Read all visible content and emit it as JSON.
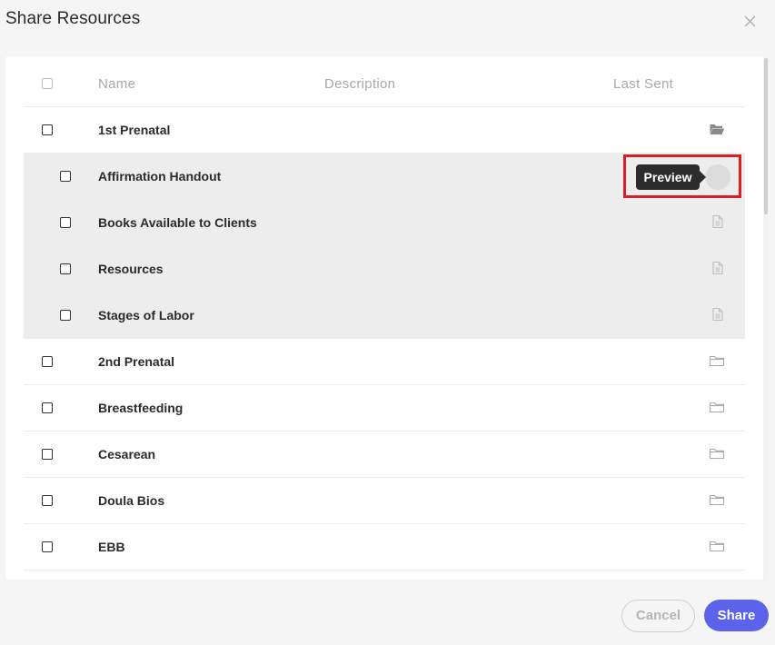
{
  "modal": {
    "title": "Share Resources"
  },
  "table": {
    "columns": {
      "name": "Name",
      "description": "Description",
      "last_sent": "Last Sent"
    },
    "rows": [
      {
        "name": "1st Prenatal",
        "type": "folder",
        "state": "open",
        "level": 0
      },
      {
        "name": "Affirmation Handout",
        "type": "file",
        "level": 1,
        "hovered": true
      },
      {
        "name": "Books Available to Clients",
        "type": "file",
        "level": 1
      },
      {
        "name": "Resources",
        "type": "file",
        "level": 1
      },
      {
        "name": "Stages of Labor",
        "type": "file",
        "level": 1
      },
      {
        "name": "2nd Prenatal",
        "type": "folder",
        "state": "closed",
        "level": 0
      },
      {
        "name": "Breastfeeding",
        "type": "folder",
        "state": "closed",
        "level": 0
      },
      {
        "name": "Cesarean",
        "type": "folder",
        "state": "closed",
        "level": 0
      },
      {
        "name": "Doula Bios",
        "type": "folder",
        "state": "closed",
        "level": 0
      },
      {
        "name": "EBB",
        "type": "folder",
        "state": "closed",
        "level": 0
      }
    ]
  },
  "tooltip": {
    "label": "Preview"
  },
  "footer": {
    "cancel_label": "Cancel",
    "share_label": "Share"
  },
  "icons": {
    "close": "close-icon",
    "folder_open": "folder-open-icon",
    "folder_closed": "folder-icon",
    "file": "file-document-icon"
  },
  "colors": {
    "accent": "#5b63ea",
    "highlight": "#d81f26",
    "tooltip_bg": "#2c2c2c",
    "child_row_bg": "#ededed"
  }
}
